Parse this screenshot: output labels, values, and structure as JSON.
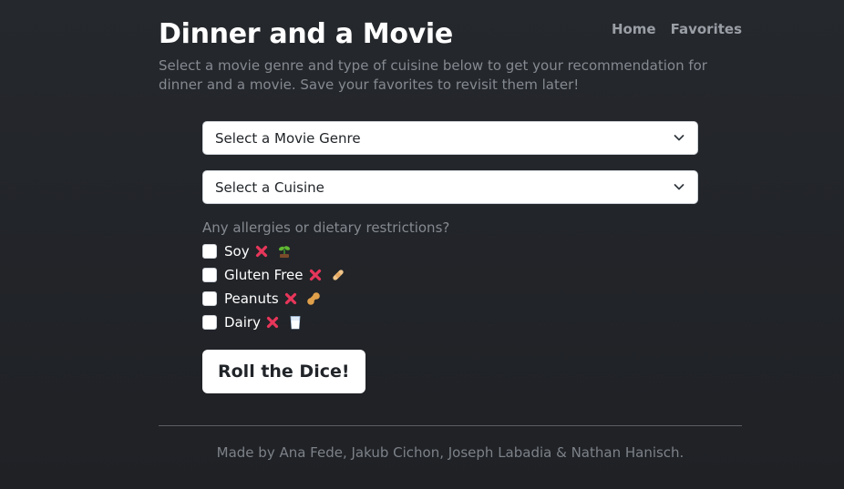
{
  "header": {
    "title": "Dinner and a Movie",
    "subtitle": "Select a movie genre and type of cuisine below to get your recommendation for dinner and a movie. Save your favorites to revisit them later!",
    "nav": {
      "home": "Home",
      "favorites": "Favorites"
    }
  },
  "form": {
    "genre_select": "Select a Movie Genre",
    "cuisine_select": "Select a Cuisine",
    "question": "Any allergies or dietary restrictions?",
    "options": [
      {
        "label": "Soy",
        "icon": "seedling-icon"
      },
      {
        "label": "Gluten Free",
        "icon": "bandage-icon"
      },
      {
        "label": "Peanuts",
        "icon": "peanut-icon"
      },
      {
        "label": "Dairy",
        "icon": "milk-glass-icon"
      }
    ],
    "submit": "Roll the Dice!"
  },
  "footer": {
    "credits": "Made by Ana Fede, Jakub Cichon, Joseph Labadia & Nathan Hanisch."
  },
  "colors": {
    "background": "#23262a",
    "accent_x": "#e8365a"
  }
}
